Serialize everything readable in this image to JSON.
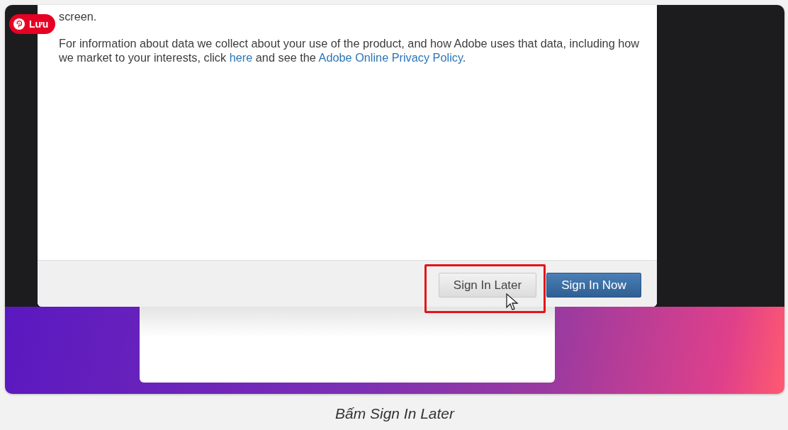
{
  "pin_button": {
    "label": "Lưu"
  },
  "dialog": {
    "paragraphs": [
      [
        {
          "text": "screen.",
          "kind": "text"
        }
      ],
      [
        {
          "text": "For information about data we collect about your use of the product, and how Adobe uses that data, including how we market to your interests, click ",
          "kind": "text"
        },
        {
          "text": "here",
          "kind": "link"
        },
        {
          "text": " and see the ",
          "kind": "text"
        },
        {
          "text": "Adobe Online Privacy Policy",
          "kind": "link"
        },
        {
          "text": ".",
          "kind": "text"
        }
      ]
    ],
    "buttons": [
      {
        "label": "Sign In Later",
        "kind": "secondary",
        "highlighted": true
      },
      {
        "label": "Sign In Now",
        "kind": "primary",
        "highlighted": false
      }
    ]
  },
  "caption": "Bấm Sign In Later"
}
